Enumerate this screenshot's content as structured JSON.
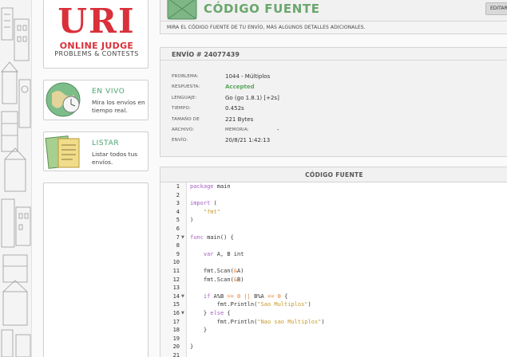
{
  "logo": {
    "line1": "URI",
    "line2": "ONLINE JUDGE",
    "line3": "PROBLEMS & CONTESTS"
  },
  "sidebar": {
    "live": {
      "title": "EN VIVO",
      "text": "Mira los envíos en tiempo real."
    },
    "list": {
      "title": "LISTAR",
      "text": "Listar todos tus envíos."
    }
  },
  "header": {
    "title": "CÓDIGO FUENTE",
    "edit_label": "EDITAR"
  },
  "subtitle": "MIRA EL CÓDIGO FUENTE DE TU ENVÍO, MÁS ALGUNOS DETALLES ADICIONALES.",
  "submission": {
    "title": "ENVÍO # 24077439",
    "fields": [
      {
        "label": "PROBLEMA:",
        "value": "1044 - Múltiplos"
      },
      {
        "label": "RESPUESTA:",
        "value": "Accepted"
      },
      {
        "label": "LENGUAJE:",
        "value": "Go (go 1.8.1) [+2s]"
      },
      {
        "label": "TIEMPO:",
        "value": "0.452s"
      },
      {
        "label": "TAMAÑO DE",
        "value": "221 Bytes"
      },
      {
        "label": "ARCHIVO:",
        "value": ""
      },
      {
        "label": "ENVÍO:",
        "value": "20/8/21 1:42:13"
      }
    ],
    "memory_label": "MEMORIA:",
    "memory_value": "-"
  },
  "code": {
    "title": "CÓDIGO FUENTE",
    "line_numbers": [
      "1",
      "2",
      "3",
      "4",
      "5",
      "6",
      "7",
      "8",
      "9",
      "10",
      "11",
      "12",
      "13",
      "14",
      "15",
      "16",
      "17",
      "18",
      "19",
      "20",
      "21"
    ]
  },
  "colors": {
    "accent_green": "#6aa66d",
    "accepted": "#59a85a",
    "logo_red": "#d9303a"
  },
  "icons": [
    "globe-clock-icon",
    "document-list-icon",
    "code-box-icon"
  ]
}
